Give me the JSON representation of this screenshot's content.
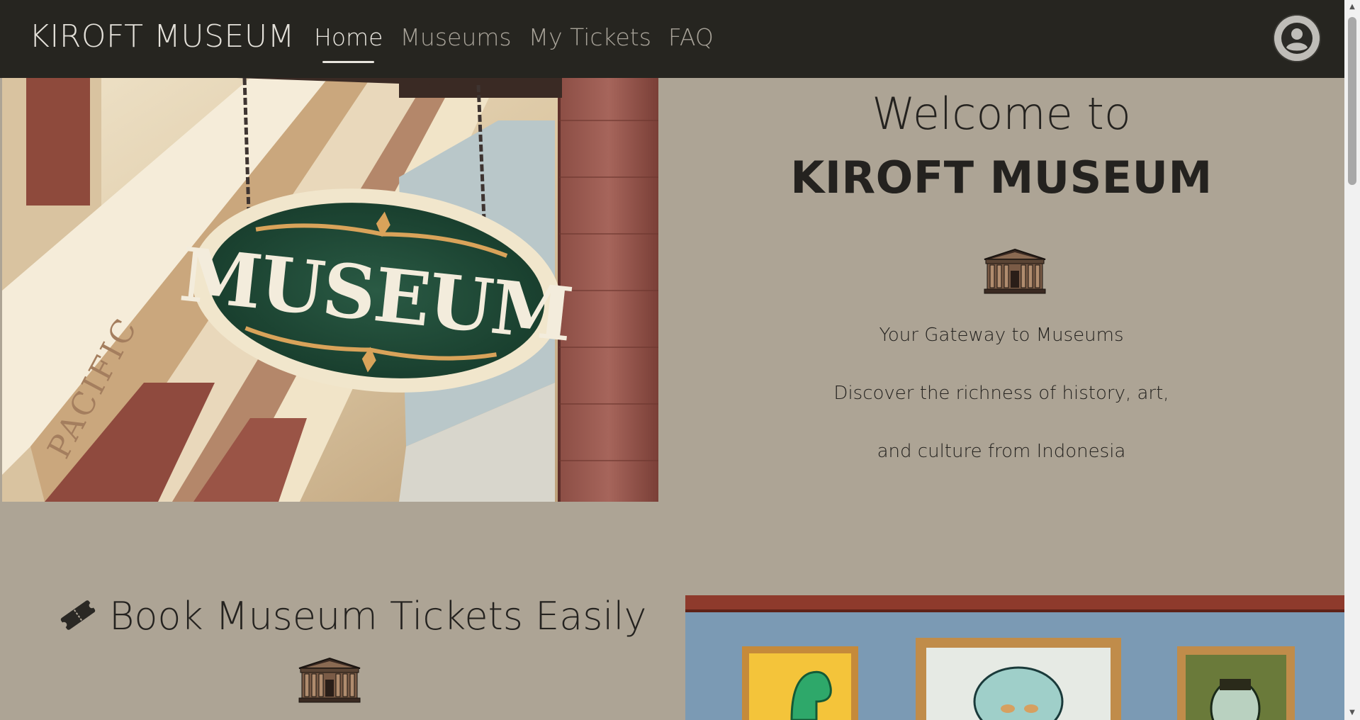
{
  "navbar": {
    "brand": "KIROFT MUSEUM",
    "links": [
      {
        "label": "Home",
        "active": true
      },
      {
        "label": "Museums",
        "active": false
      },
      {
        "label": "My Tickets",
        "active": false
      },
      {
        "label": "FAQ",
        "active": false
      }
    ],
    "avatar_icon": "user-avatar-icon"
  },
  "hero": {
    "image_icon": "museum-sign-photo",
    "sign_text": "MUSEUM",
    "building_text": "PACIFIC"
  },
  "welcome": {
    "line1": "Welcome to",
    "line2": "KIROFT MUSEUM",
    "icon": "museum-building-icon",
    "tagline": "Your Gateway to Museums",
    "desc1": "Discover the richness of history, art,",
    "desc2": "and culture from Indonesia"
  },
  "book": {
    "icon": "ticket-icon",
    "title": "Book Museum Tickets Easily",
    "building_icon": "museum-building-icon"
  },
  "gallery": {
    "image_icon": "gallery-paintings-photo"
  },
  "colors": {
    "navbar_bg": "#262520",
    "page_bg": "#ada495",
    "text": "#24221f",
    "nav_active": "#e8e5de",
    "nav_inactive": "#a8a399"
  }
}
